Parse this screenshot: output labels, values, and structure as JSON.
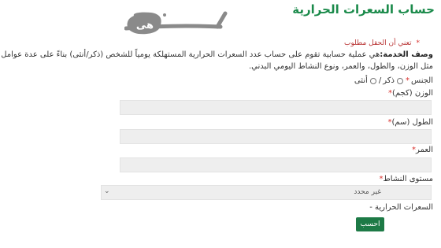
{
  "page": {
    "title": "حساب السعرات الحرارية",
    "logo_text": "هى"
  },
  "form": {
    "required_note": "تعني أن الحقل مطلوب",
    "required_star": "*",
    "description_label": "وصف الخدمة:",
    "description_text": "هي عملية حسابية تقوم على حساب عدد السعرات الحرارية المستهلكة يومياً للشخص (ذكر/أنثى) بناءً على عدة عوامل مثل الوزن، والطول، والعمر، ونوع النشاط اليومي البدني.",
    "gender_label": "الجنس",
    "gender_options": [
      "ذكر",
      "أنثى"
    ],
    "weight_label": "الوزن (كجم)",
    "height_label": "الطول (سم)",
    "age_label": "العمر",
    "activity_label": "مستوى النشاط",
    "activity_selected": "غير محدد",
    "result_label": "السعرات الحرارية -",
    "submit_label": "احسب"
  },
  "colors": {
    "brand_green": "#1a8a4a",
    "button_green": "#1d7a46",
    "required_red": "#d9302c"
  }
}
